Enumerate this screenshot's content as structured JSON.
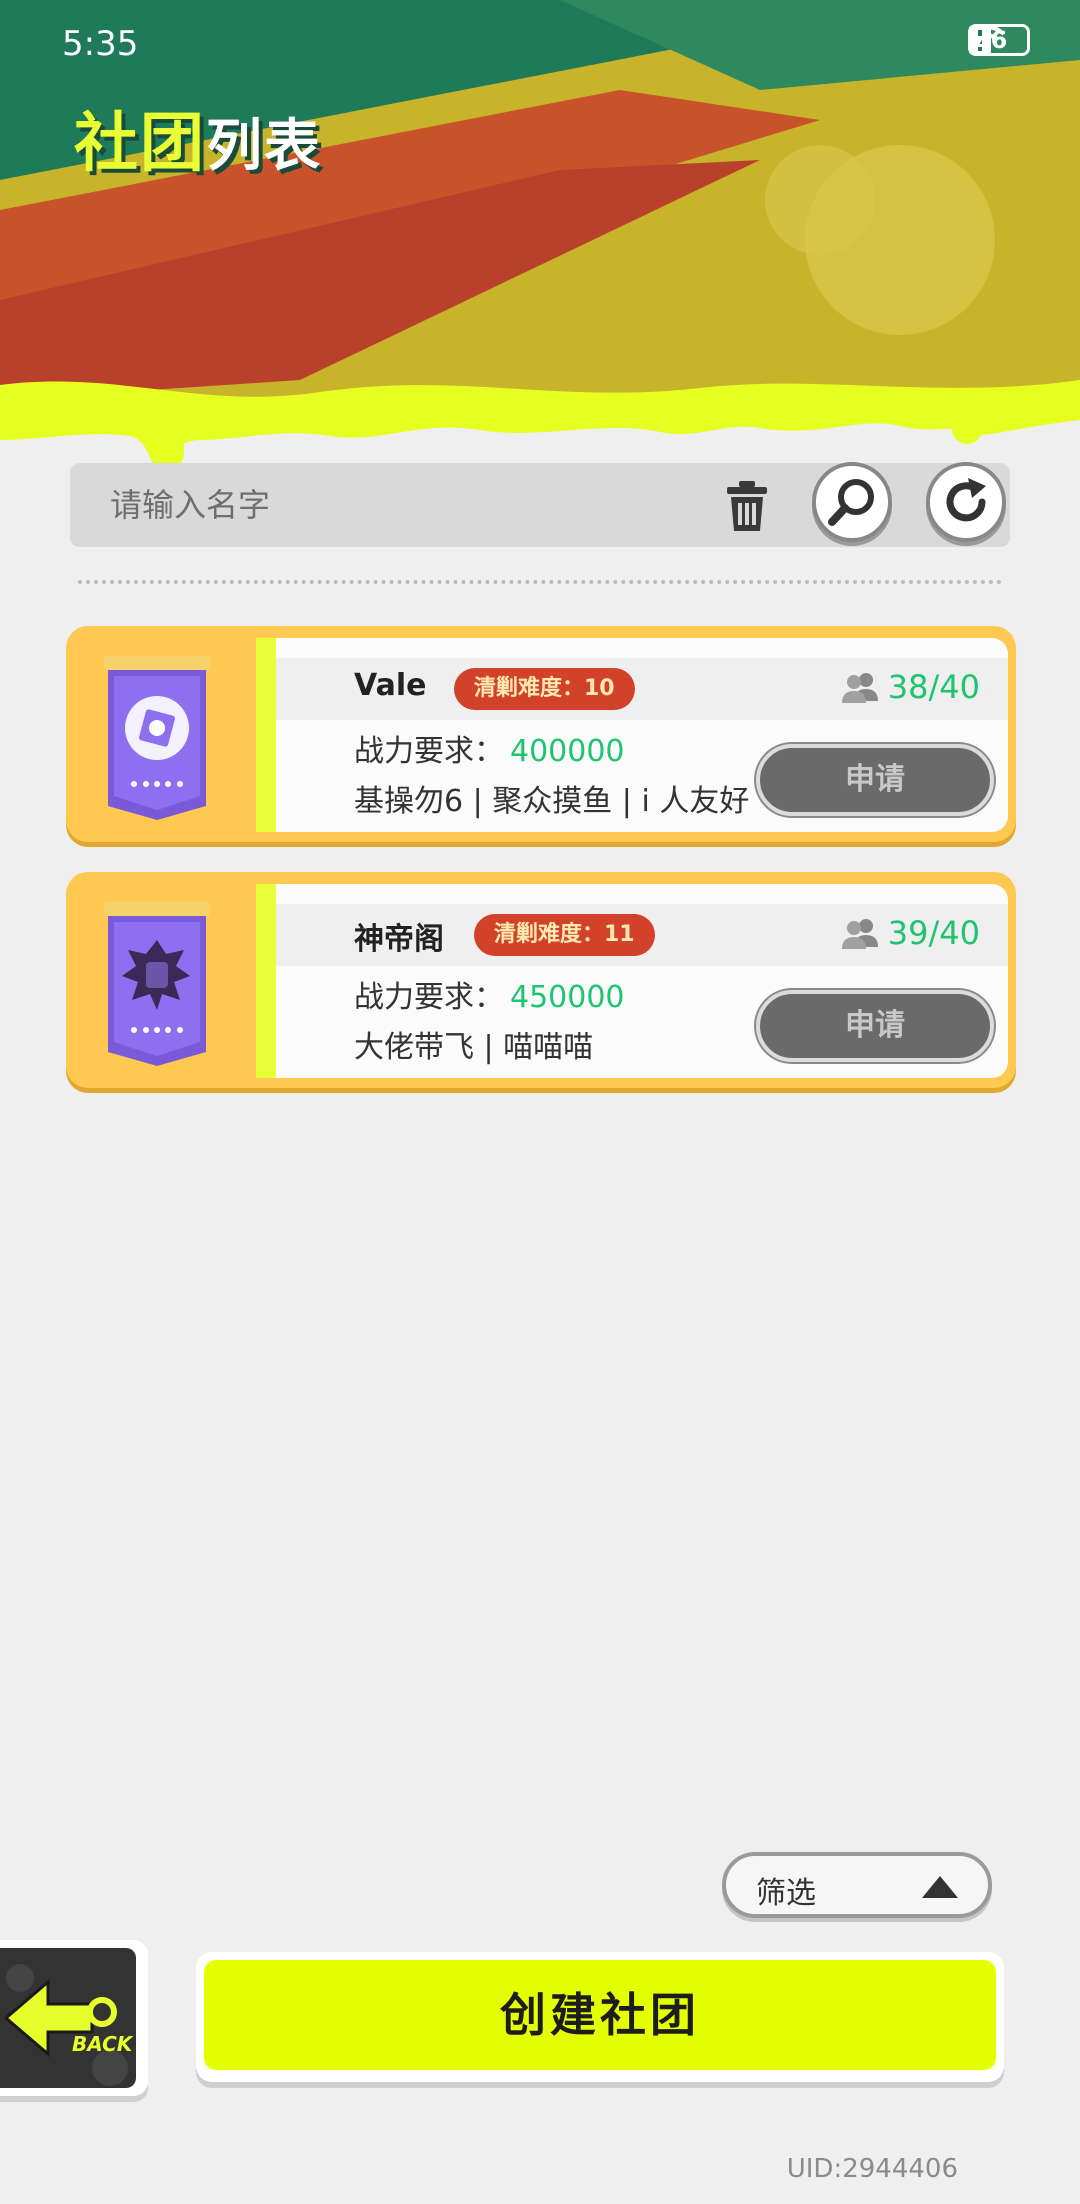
{
  "status_bar": {
    "time": "5:35",
    "battery": "6"
  },
  "header": {
    "title_part1": "社团",
    "title_part2": "列表"
  },
  "search": {
    "placeholder": "请输入名字",
    "value": ""
  },
  "clubs": [
    {
      "name": "Vale",
      "difficulty": "清剿难度：10",
      "members": "38/40",
      "power_label": "战力要求：",
      "power_value": "400000",
      "motto": "基操勿6 | 聚众摸鱼 | i 人友好",
      "apply_label": "申请"
    },
    {
      "name": "神帝阁",
      "difficulty": "清剿难度：11",
      "members": "39/40",
      "power_label": "战力要求：",
      "power_value": "450000",
      "motto": "大佬带飞 | 喵喵喵",
      "apply_label": "申请"
    }
  ],
  "filter": {
    "label": "筛选"
  },
  "back": {
    "label": "BACK"
  },
  "create": {
    "label": "创建社团"
  },
  "uid": "UID:2944406",
  "colors": {
    "accent_yellow": "#e3ff00",
    "member_green": "#1ec46e",
    "badge_red": "#d2412a",
    "card_orange": "#ffc850"
  }
}
